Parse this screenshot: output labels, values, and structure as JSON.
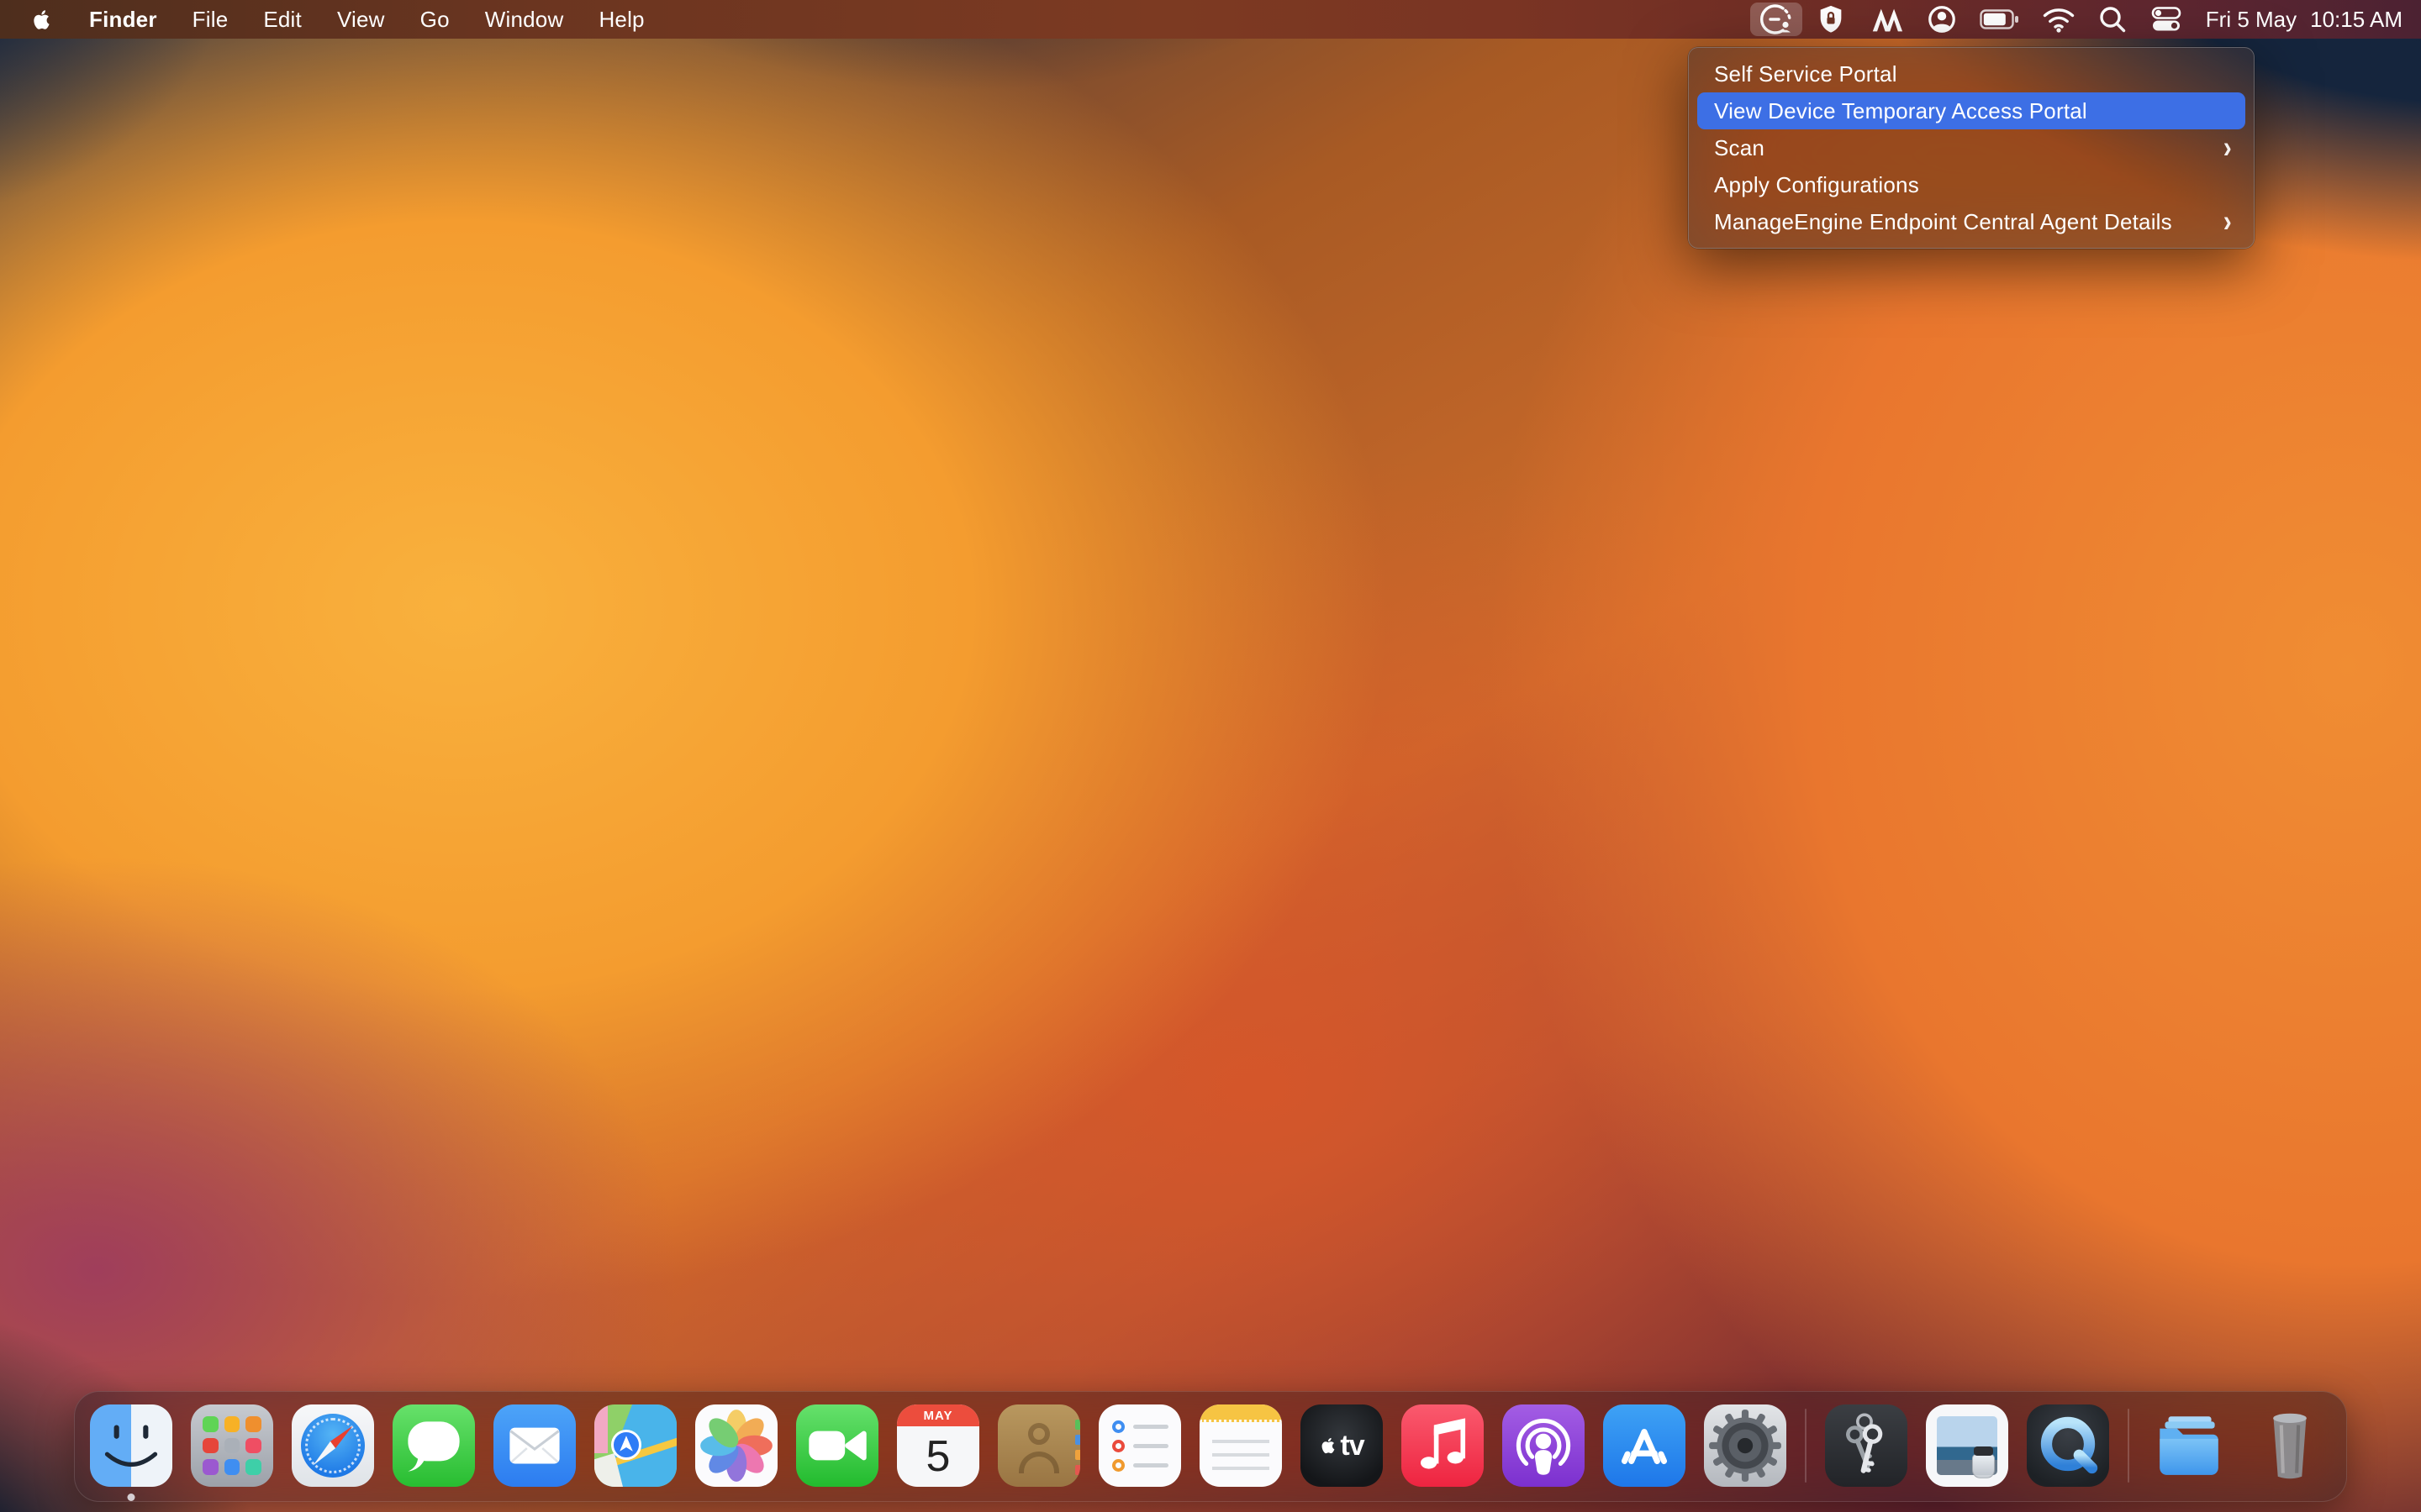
{
  "menubar": {
    "left_items": [
      "Finder",
      "File",
      "Edit",
      "View",
      "Go",
      "Window",
      "Help"
    ],
    "status_icons": [
      "endpoint-central-agent",
      "security-shield",
      "manageengine-logo",
      "user-account",
      "battery",
      "wifi",
      "spotlight-search",
      "control-center"
    ],
    "clock": {
      "date": "Fri 5 May",
      "time": "10:15 AM"
    }
  },
  "agent_menu": {
    "items": [
      {
        "label": "Self Service Portal",
        "has_submenu": false,
        "highlighted": false
      },
      {
        "label": "View Device Temporary Access Portal",
        "has_submenu": false,
        "highlighted": true
      },
      {
        "label": "Scan",
        "has_submenu": true,
        "highlighted": false
      },
      {
        "label": "Apply Configurations",
        "has_submenu": false,
        "highlighted": false
      },
      {
        "label": "ManageEngine Endpoint Central Agent Details",
        "has_submenu": true,
        "highlighted": false
      }
    ]
  },
  "icons": {
    "submenu_chevron": "›"
  },
  "dock": {
    "apps": [
      "Finder",
      "Launchpad",
      "Safari",
      "Messages",
      "Mail",
      "Maps",
      "Photos",
      "FaceTime",
      "Calendar",
      "Contacts",
      "Reminders",
      "Notes",
      "TV",
      "Music",
      "Podcasts",
      "App Store",
      "System Settings",
      "Keychain Access",
      "Preview",
      "QuickTime Player",
      "Downloads",
      "Trash"
    ],
    "running_apps": [
      "Finder"
    ],
    "calendar": {
      "month": "MAY",
      "day": "5"
    },
    "tv_label": "tv"
  },
  "colors": {
    "menu_highlight": "#3d6fe5",
    "menubar_tint": "#7c3a22",
    "dock_background": "rgba(40,36,42,0.48)",
    "wallpaper_orange": "#f49c2f",
    "wallpaper_navy": "#14243c"
  }
}
